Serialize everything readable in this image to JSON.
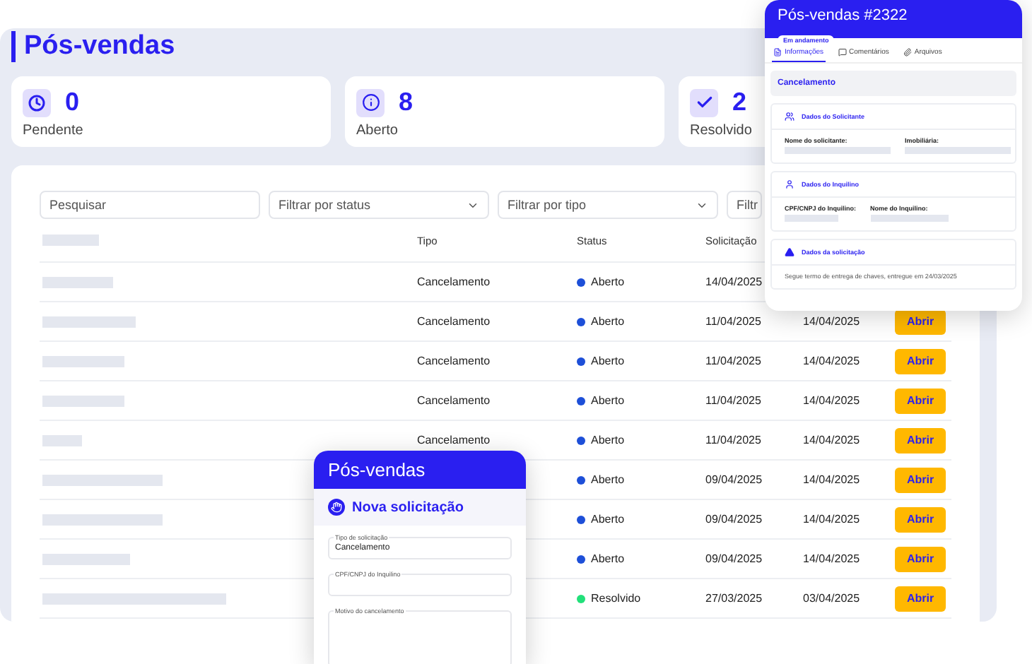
{
  "page": {
    "title": "Pós-vendas"
  },
  "stats": [
    {
      "kind": "pending",
      "value": "0",
      "label": "Pendente"
    },
    {
      "kind": "open",
      "value": "8",
      "label": "Aberto"
    },
    {
      "kind": "resolved",
      "value": "2",
      "label": "Resolvido"
    }
  ],
  "filters": [
    {
      "kind": "search",
      "placeholder": "Pesquisar"
    },
    {
      "kind": "select",
      "placeholder": "Filtrar por status"
    },
    {
      "kind": "select",
      "placeholder": "Filtrar por tipo"
    },
    {
      "kind": "select",
      "placeholder": "Filtr"
    }
  ],
  "table": {
    "columns": [
      "Tipo",
      "Status",
      "Solicitação"
    ],
    "rows": [
      {
        "tipo": "Cancelamento",
        "status": {
          "label": "Aberto",
          "color": "#1d4fd8"
        },
        "solicitacao": "14/04/2025"
      },
      {
        "tipo": "Cancelamento",
        "status": {
          "label": "Aberto",
          "color": "#1d4fd8"
        },
        "solicitacao": "11/04/2025",
        "column_5": "14/04/2025",
        "action": "Abrir"
      },
      {
        "tipo": "Cancelamento",
        "status": {
          "label": "Aberto",
          "color": "#1d4fd8"
        },
        "solicitacao": "11/04/2025",
        "column_5": "14/04/2025",
        "action": "Abrir"
      },
      {
        "tipo": "Cancelamento",
        "status": {
          "label": "Aberto",
          "color": "#1d4fd8"
        },
        "solicitacao": "11/04/2025",
        "column_5": "14/04/2025",
        "action": "Abrir"
      },
      {
        "tipo": "Cancelamento",
        "status": {
          "label": "Aberto",
          "color": "#1d4fd8"
        },
        "solicitacao": "11/04/2025",
        "column_5": "14/04/2025",
        "action": "Abrir"
      },
      {
        "status": {
          "label": "Aberto",
          "color": "#1d4fd8"
        },
        "solicitacao": "09/04/2025",
        "column_5": "14/04/2025",
        "action": "Abrir"
      },
      {
        "status": {
          "label": "Aberto",
          "color": "#1d4fd8"
        },
        "solicitacao": "09/04/2025",
        "column_5": "14/04/2025",
        "action": "Abrir"
      },
      {
        "status": {
          "label": "Aberto",
          "color": "#1d4fd8"
        },
        "solicitacao": "09/04/2025",
        "column_5": "14/04/2025",
        "action": "Abrir"
      },
      {
        "status": {
          "label": "Resolvido",
          "color": "#22e07a"
        },
        "solicitacao": "27/03/2025",
        "column_5": "03/04/2025",
        "action": "Abrir"
      }
    ]
  },
  "detail": {
    "title": "Pós-vendas #2322",
    "badge": "Em andamento",
    "tabs": [
      {
        "kind": "info",
        "label": "Informações",
        "selected": true
      },
      {
        "kind": "comments",
        "label": "Comentários",
        "selected": false
      },
      {
        "kind": "files",
        "label": "Arquivos",
        "selected": false
      }
    ],
    "type": "Cancelamento",
    "sections": [
      {
        "kind": "requester",
        "title": "Dados do Solicitante",
        "fields": [
          "Nome do solicitante:",
          "Imobiliária:"
        ]
      },
      {
        "kind": "tenant",
        "title": "Dados do Inquilino",
        "fields": [
          "CPF/CNPJ do Inquilino:",
          "Nome do Inquilino:"
        ]
      },
      {
        "kind": "request",
        "title": "Dados da solicitação",
        "text": "Segue termo de entrega de chaves, entregue em 24/03/2025"
      }
    ]
  },
  "form": {
    "title": "Pós-vendas",
    "heading": "Nova solicitação",
    "fields": [
      {
        "kind": "select",
        "label": "Tipo de solicitação",
        "value": "Cancelamento"
      },
      {
        "kind": "input",
        "label": "CPF/CNPJ do Inquilino"
      },
      {
        "kind": "textarea",
        "label": "Motivo do cancelamento"
      }
    ]
  }
}
